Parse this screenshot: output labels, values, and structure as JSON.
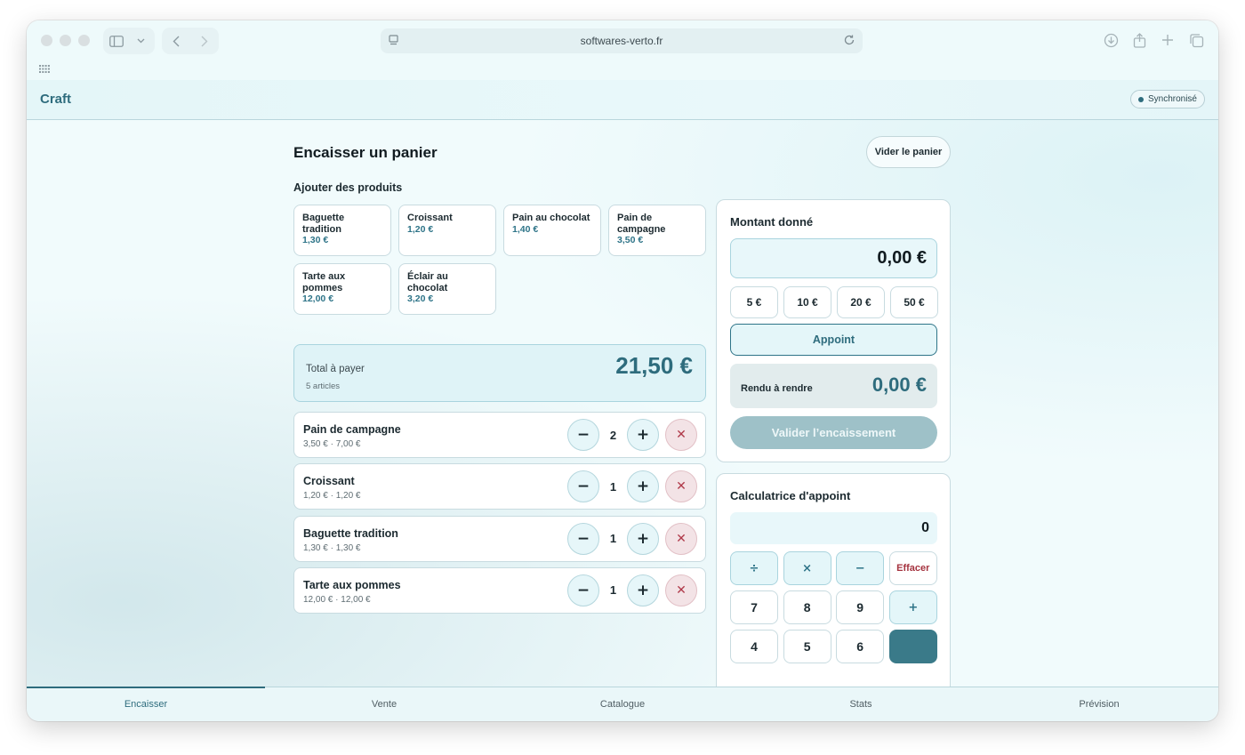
{
  "browser": {
    "url": "softwares-verto.fr"
  },
  "app": {
    "brand": "Craft",
    "sync_status": "Synchronisé"
  },
  "page": {
    "title": "Encaisser un panier",
    "clear_cart_label": "Vider le panier",
    "add_products_label": "Ajouter des produits"
  },
  "products": [
    {
      "name": "Baguette tradition",
      "price": "1,30 €"
    },
    {
      "name": "Croissant",
      "price": "1,20 €"
    },
    {
      "name": "Pain au chocolat",
      "price": "1,40 €"
    },
    {
      "name": "Pain de campagne",
      "price": "3,50 €"
    },
    {
      "name": "Tarte aux pommes",
      "price": "12,00 €"
    },
    {
      "name": "Éclair au chocolat",
      "price": "3,20 €"
    }
  ],
  "total": {
    "label": "Total à payer",
    "count": "5 articles",
    "value": "21,50 €"
  },
  "cart": [
    {
      "name": "Pain de campagne",
      "sub": "3,50 € · 7,00 €",
      "qty": "2"
    },
    {
      "name": "Croissant",
      "sub": "1,20 € · 1,20 €",
      "qty": "1"
    },
    {
      "name": "Baguette tradition",
      "sub": "1,30 € · 1,30 €",
      "qty": "1"
    },
    {
      "name": "Tarte aux pommes",
      "sub": "12,00 € · 12,00 €",
      "qty": "1"
    }
  ],
  "payment": {
    "title": "Montant donné",
    "amount": "0,00 €",
    "quick_amounts": [
      "5 €",
      "10 €",
      "20 €",
      "50 €"
    ],
    "exact_label": "Appoint",
    "change_label": "Rendu à rendre",
    "change_value": "0,00 €",
    "validate_label": "Valider l’encaissement"
  },
  "calculator": {
    "title": "Calculatrice d'appoint",
    "display": "0",
    "keys": [
      "÷",
      "×",
      "−",
      "Effacer",
      "7",
      "8",
      "9",
      "+",
      "4",
      "5",
      "6",
      ""
    ]
  },
  "tabs": [
    "Encaisser",
    "Vente",
    "Catalogue",
    "Stats",
    "Prévision"
  ],
  "colors": {
    "accent": "#2e6c7d",
    "remove": "#b03a4a",
    "background": "#f1fbfc"
  }
}
